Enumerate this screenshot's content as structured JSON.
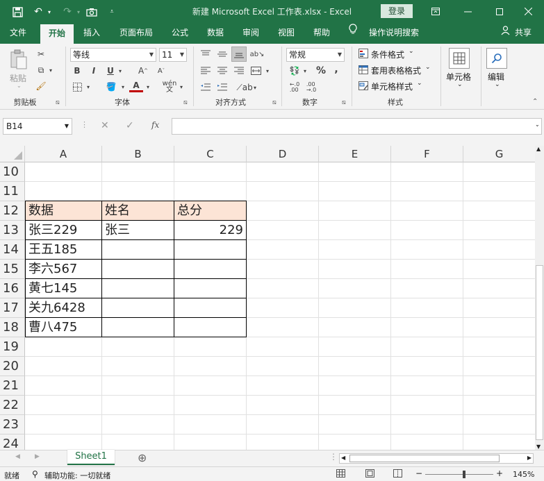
{
  "window": {
    "title": "新建 Microsoft Excel 工作表.xlsx  -  Excel",
    "login_label": "登录"
  },
  "ribbon_tabs": [
    {
      "label": "文件"
    },
    {
      "label": "开始"
    },
    {
      "label": "插入"
    },
    {
      "label": "页面布局"
    },
    {
      "label": "公式"
    },
    {
      "label": "数据"
    },
    {
      "label": "审阅"
    },
    {
      "label": "视图"
    },
    {
      "label": "帮助"
    },
    {
      "label": "操作说明搜索"
    }
  ],
  "share_label": "共享",
  "ribbon": {
    "clipboard": {
      "paste_label": "粘贴",
      "group_label": "剪贴板"
    },
    "font": {
      "font_name": "等线",
      "font_size": "11",
      "group_label": "字体",
      "bold": "B",
      "italic": "I",
      "underline": "U",
      "wen": "wén"
    },
    "alignment": {
      "group_label": "对齐方式"
    },
    "number": {
      "format": "常规",
      "group_label": "数字",
      "percent": "%",
      "comma": ","
    },
    "styles": {
      "conditional": "条件格式",
      "table_format": "套用表格格式",
      "cell_styles": "单元格样式",
      "group_label": "样式"
    },
    "cells": {
      "label": "单元格"
    },
    "editing": {
      "label": "编辑"
    }
  },
  "formula_bar": {
    "name_box": "B14",
    "formula": ""
  },
  "grid": {
    "columns": [
      "A",
      "B",
      "C",
      "D",
      "E",
      "F",
      "G"
    ],
    "rows": [
      "10",
      "11",
      "12",
      "13",
      "14",
      "15",
      "16",
      "17",
      "18",
      "19",
      "20",
      "21",
      "22",
      "23",
      "24"
    ],
    "table_header": [
      "数据",
      "姓名",
      "总分"
    ],
    "table_rows": [
      [
        "张三229",
        "张三",
        "229"
      ],
      [
        "王五185",
        "",
        ""
      ],
      [
        "李六567",
        "",
        ""
      ],
      [
        "黄七145",
        "",
        ""
      ],
      [
        "关九6428",
        "",
        ""
      ],
      [
        "曹八475",
        "",
        ""
      ]
    ],
    "header_fill": "#fce4d6"
  },
  "sheets": [
    {
      "name": "Sheet1"
    }
  ],
  "status": {
    "ready": "就绪",
    "accessibility": "辅助功能: 一切就绪",
    "zoom": "145%"
  },
  "colors": {
    "accent": "#217346"
  }
}
